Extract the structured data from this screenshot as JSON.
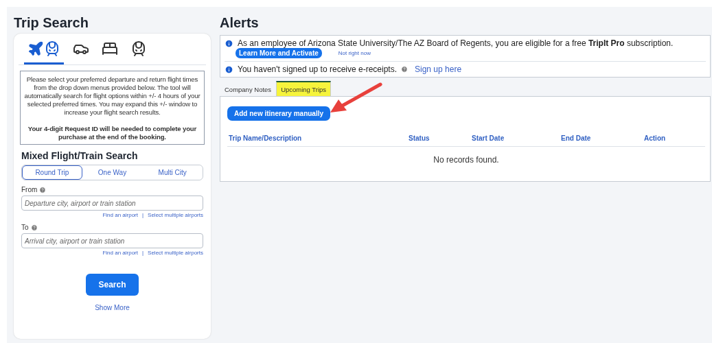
{
  "trip_search": {
    "title": "Trip Search",
    "modes": [
      {
        "kind": "flight-train",
        "selected": true
      },
      {
        "kind": "car",
        "selected": false
      },
      {
        "kind": "hotel",
        "selected": false
      },
      {
        "kind": "train",
        "selected": false
      }
    ],
    "notice": [
      "Please select your preferred departure and return flight times from the drop down menus provided below. The tool will automatically search for flight options within +/- 4 hours of your selected preferred times. You may expand this +/- window to increase your flight search results.",
      "Your 4-digit Request ID will be needed to complete your purchase at the end of the booking."
    ],
    "subtitle": "Mixed Flight/Train Search",
    "trip_types": [
      {
        "label": "Round Trip",
        "selected": true
      },
      {
        "label": "One Way",
        "selected": false
      },
      {
        "label": "Multi City",
        "selected": false
      }
    ],
    "fields": [
      {
        "label": "From",
        "placeholder": "Departure city, airport or train station",
        "links": [
          "Find an airport",
          "|",
          "Select multiple airports"
        ]
      },
      {
        "label": "To",
        "placeholder": "Arrival city, airport or train station",
        "links": [
          "Find an airport",
          "|",
          "Select multiple airports"
        ]
      }
    ],
    "search_button": "Search",
    "show_more": "Show More"
  },
  "alerts": {
    "title": "Alerts",
    "items": [
      {
        "text": "As an employee of Arizona State University/The AZ Board of Regents, you are eligible for a free **TripIt Pro** subscription.",
        "button": "Learn More and Activate",
        "link": "Not right now"
      },
      {
        "text": "You haven't signed up to receive e-receipts.",
        "help": true,
        "link": "Sign up here"
      }
    ]
  },
  "tabs": [
    {
      "label": "Company Notes",
      "selected": false,
      "highlighted": false
    },
    {
      "label": "Upcoming Trips",
      "selected": true,
      "highlighted": true
    }
  ],
  "add_button": "Add new itinerary manually",
  "table": {
    "columns": [
      "Trip Name/Description",
      "Status",
      "Start Date",
      "End Date",
      "Action"
    ],
    "empty": "No records found."
  }
}
